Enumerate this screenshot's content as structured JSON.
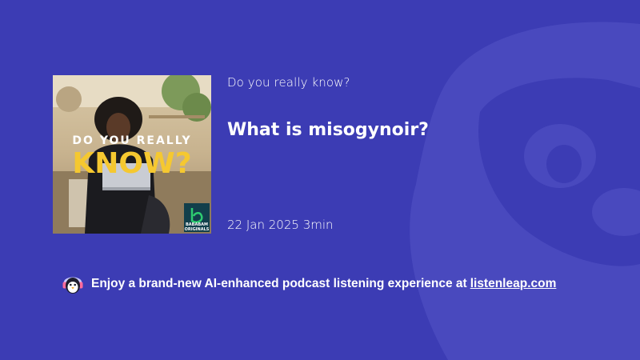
{
  "podcast": {
    "show_name": "Do you really know?",
    "episode_title": "What is misogynoir?",
    "date": "22 Jan 2025",
    "duration": "3min",
    "cover": {
      "line1": "DO YOU REALLY",
      "line2": "KNOW?",
      "badge_line1": "BABABAM",
      "badge_line2": "ORIGINALS"
    }
  },
  "promo": {
    "text": "Enjoy a brand-new AI-enhanced podcast listening experience at",
    "link_label": "listenleap.com"
  },
  "colors": {
    "background": "#3c3cb4",
    "mascot_watermark": "#4a4ac0",
    "cover_title_yellow": "#f5c830",
    "badge_green": "#2ecc71"
  },
  "icons": {
    "mascot": "penguin-logo-icon",
    "watermark": "mascot-watermark"
  }
}
